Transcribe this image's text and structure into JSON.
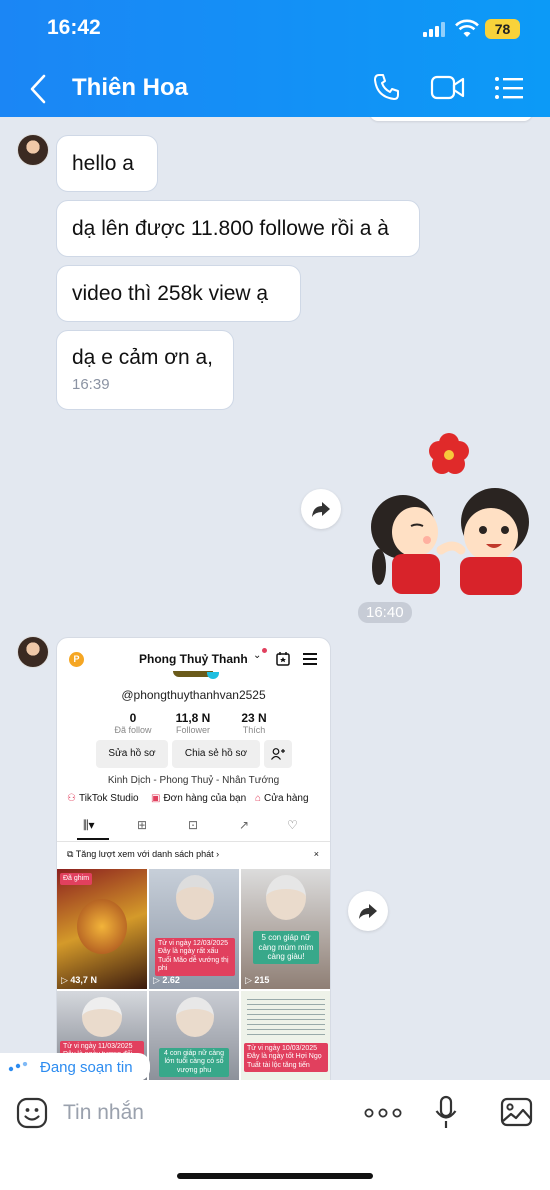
{
  "status_bar": {
    "time": "16:42",
    "battery": "78"
  },
  "header": {
    "contact_name": "Thiên Hoa"
  },
  "messages": [
    {
      "text": "hello a"
    },
    {
      "text": "dạ lên được 11.800 followe rồi a à"
    },
    {
      "text": "video thì 258k view ạ"
    },
    {
      "text": "dạ e cảm ơn a,",
      "time": "16:39"
    }
  ],
  "sticker_time": "16:40",
  "tiktok_screenshot": {
    "profile_name": "Phong Thuỷ Thanh…",
    "handle": "@phongthuythanhvan2525",
    "stats": [
      {
        "value": "0",
        "label": "Đã follow"
      },
      {
        "value": "11,8 N",
        "label": "Follower"
      },
      {
        "value": "23 N",
        "label": "Thích"
      }
    ],
    "edit_profile": "Sửa hồ sơ",
    "share_profile": "Chia sẻ hồ sơ",
    "bio": "Kinh Dịch - Phong Thuỷ - Nhân Tướng",
    "links": [
      "TikTok Studio",
      "Đơn hàng của bạn",
      "Cửa hàng"
    ],
    "playlist_prompt": "Tăng lượt xem với danh sách phát",
    "videos": [
      {
        "badge": "Đã ghim",
        "views": "43,7 N"
      },
      {
        "caption": "Tử vi ngày 12/03/2025 Đây là ngày rất xấu Tuổi Mão dễ vướng thị phi",
        "views": "2.62"
      },
      {
        "caption": "5 con giáp nữ càng múm mím càng giàu!",
        "views": "215"
      },
      {
        "caption": "Tử vi ngày 11/03/2025 Đây là ngày tương đối tốt"
      },
      {
        "caption": "4 con giáp nữ càng lớn tuổi càng có số vượng phu"
      },
      {
        "caption": "Tử vi ngày 10/03/2025 Đây là ngày tốt Hợi Ngọ Tuất tài lộc tăng tiến"
      }
    ]
  },
  "typing_indicator": "Đang soạn tin",
  "input": {
    "placeholder": "Tin nhắn"
  },
  "colors": {
    "header": "#1b86f5",
    "chat_bg": "#e3e8f0",
    "typing": "#2d8cf0"
  }
}
